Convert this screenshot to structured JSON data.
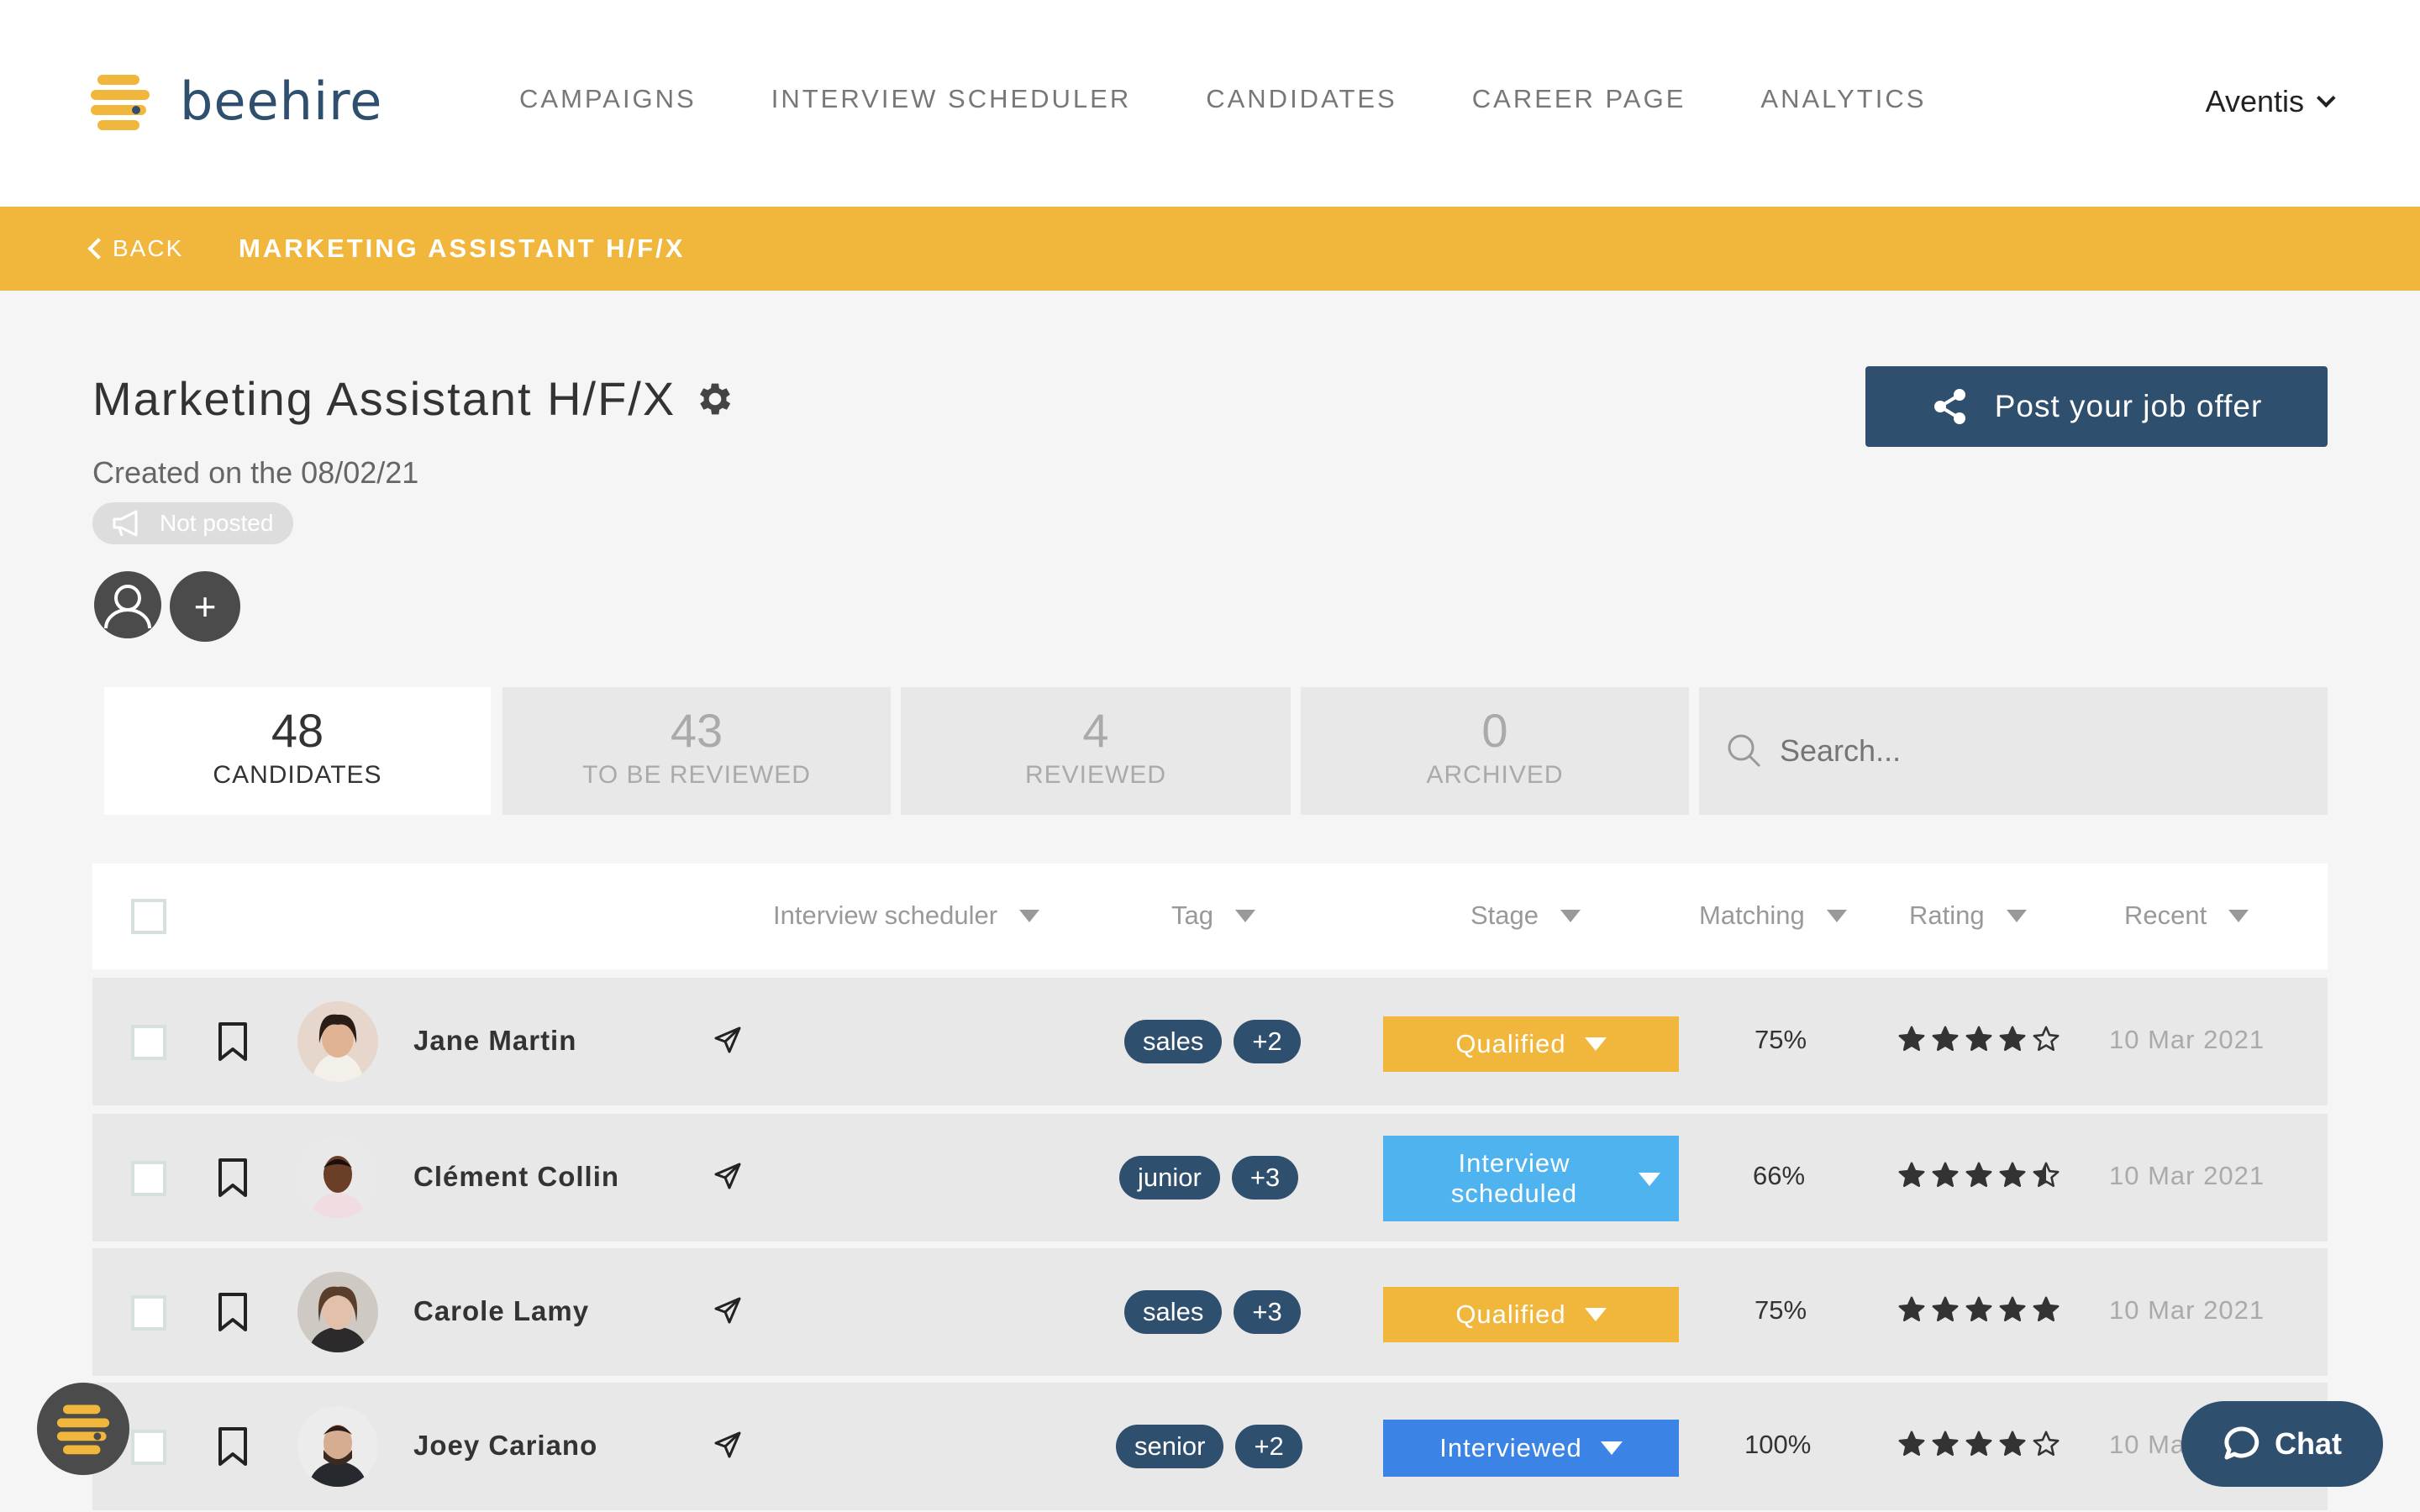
{
  "brand": {
    "name": "beehire",
    "accent": "#f1b73d",
    "primary": "#2f4f6e"
  },
  "nav": {
    "items": [
      "CAMPAIGNS",
      "INTERVIEW SCHEDULER",
      "CANDIDATES",
      "CAREER PAGE",
      "ANALYTICS"
    ],
    "account": "Aventis"
  },
  "subbar": {
    "back": "BACK",
    "title": "MARKETING ASSISTANT H/F/X"
  },
  "job": {
    "title": "Marketing Assistant H/F/X",
    "created": "Created on the 08/02/21",
    "status": "Not posted",
    "post_button": "Post your job offer"
  },
  "tabs": [
    {
      "count": "48",
      "label": "CANDIDATES"
    },
    {
      "count": "43",
      "label": "TO BE REVIEWED"
    },
    {
      "count": "4",
      "label": "REVIEWED"
    },
    {
      "count": "0",
      "label": "ARCHIVED"
    }
  ],
  "search": {
    "placeholder": "Search..."
  },
  "columns": {
    "interview": "Interview scheduler",
    "tag": "Tag",
    "stage": "Stage",
    "matching": "Matching",
    "rating": "Rating",
    "recent": "Recent"
  },
  "rows": [
    {
      "name": "Jane Martin",
      "tags": [
        "sales",
        "+2"
      ],
      "stage": "Qualified",
      "stage_color": "#f1b73d",
      "matching": "75%",
      "rating": 4,
      "date": "10 Mar 2021"
    },
    {
      "name": "Clément Collin",
      "tags": [
        "junior",
        "+3"
      ],
      "stage": "Interview scheduled",
      "stage_color": "#4fb3ef",
      "matching": "66%",
      "rating": 4.5,
      "date": "10 Mar 2021"
    },
    {
      "name": "Carole Lamy",
      "tags": [
        "sales",
        "+3"
      ],
      "stage": "Qualified",
      "stage_color": "#f1b73d",
      "matching": "75%",
      "rating": 5,
      "date": "10 Mar 2021"
    },
    {
      "name": "Joey Cariano",
      "tags": [
        "senior",
        "+2"
      ],
      "stage": "Interviewed",
      "stage_color": "#3c83e6",
      "matching": "100%",
      "rating": 4,
      "date": "10 Ma"
    }
  ],
  "chat": {
    "label": "Chat"
  }
}
